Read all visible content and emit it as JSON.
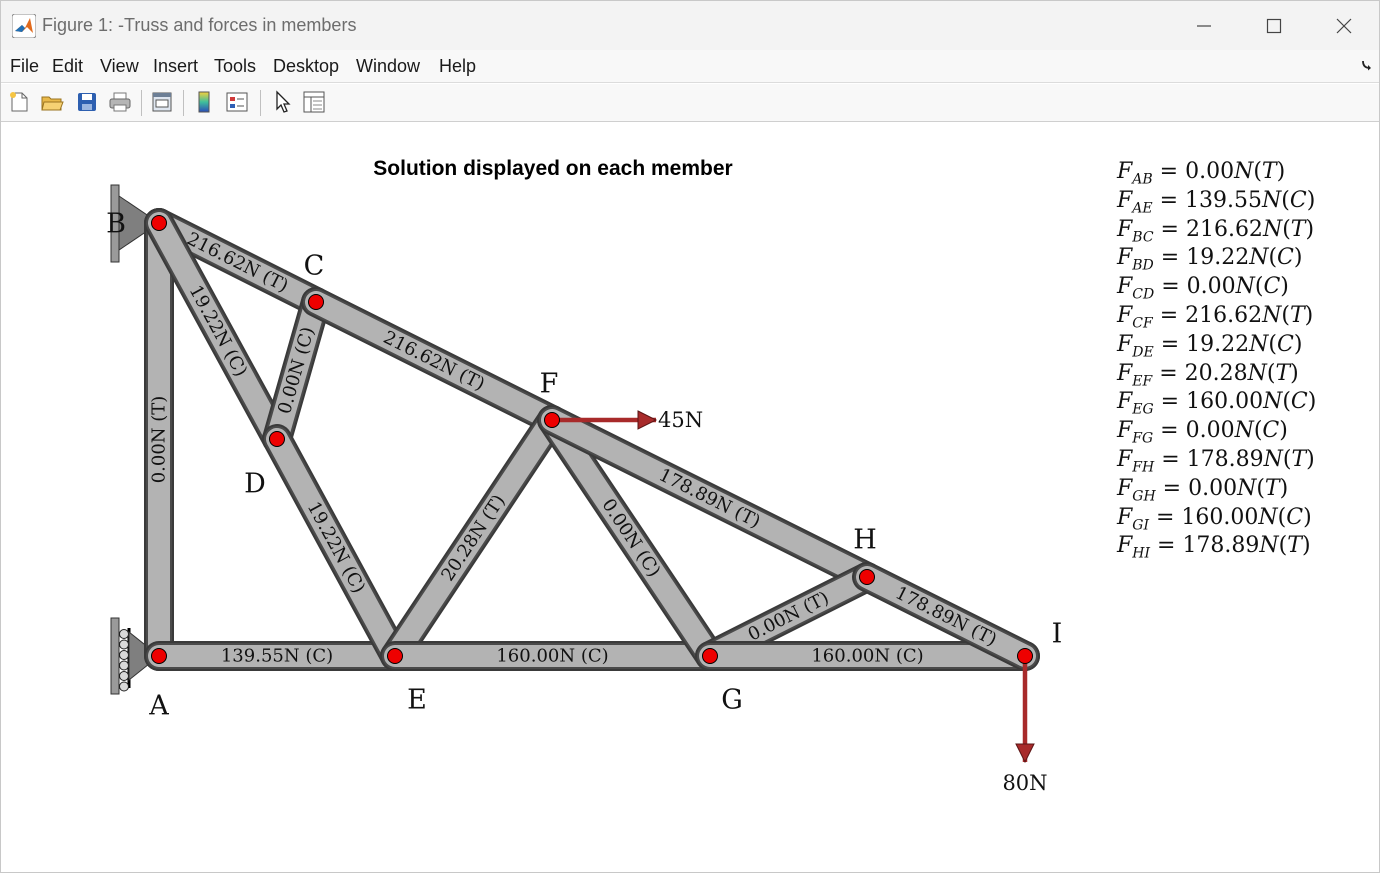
{
  "window": {
    "title": "Figure 1: -Truss and forces in members",
    "controls": [
      "minimize",
      "maximize",
      "close"
    ]
  },
  "menu": [
    "File",
    "Edit",
    "View",
    "Insert",
    "Tools",
    "Desktop",
    "Window",
    "Help"
  ],
  "toolbar": {
    "icons": [
      "new-figure-icon",
      "open-file-icon",
      "save-icon",
      "print-icon",
      "link-plot-icon",
      "colorbar-icon",
      "legend-icon",
      "pointer-icon",
      "property-inspector-icon"
    ]
  },
  "figure": {
    "title": "Solution displayed on each member",
    "nodes": [
      "A",
      "B",
      "C",
      "D",
      "E",
      "F",
      "G",
      "H",
      "I"
    ],
    "members": [
      {
        "id": "AB",
        "label": "0.00N (T)"
      },
      {
        "id": "AE",
        "label": "139.55N (C)"
      },
      {
        "id": "BC",
        "label": "216.62N (T)"
      },
      {
        "id": "BD",
        "label": "19.22N (C)"
      },
      {
        "id": "CD",
        "label": "0.00N (C)"
      },
      {
        "id": "CF",
        "label": "216.62N (T)"
      },
      {
        "id": "DE",
        "label": "19.22N (C)"
      },
      {
        "id": "EF",
        "label": "20.28N (T)"
      },
      {
        "id": "EG",
        "label": "160.00N (C)"
      },
      {
        "id": "FG",
        "label": "0.00N (C)"
      },
      {
        "id": "FH",
        "label": "178.89N (T)"
      },
      {
        "id": "GH",
        "label": "0.00N (T)"
      },
      {
        "id": "GI",
        "label": "160.00N (C)"
      },
      {
        "id": "HI",
        "label": "178.89N (T)"
      }
    ],
    "loads": [
      {
        "node": "F",
        "label": "45N",
        "direction": "right"
      },
      {
        "node": "I",
        "label": "80N",
        "direction": "down"
      }
    ],
    "results": [
      {
        "sub": "AB",
        "value": "0.00",
        "unit": "N",
        "type": "T"
      },
      {
        "sub": "AE",
        "value": "139.55",
        "unit": "N",
        "type": "C"
      },
      {
        "sub": "BC",
        "value": "216.62",
        "unit": "N",
        "type": "T"
      },
      {
        "sub": "BD",
        "value": "19.22",
        "unit": "N",
        "type": "C"
      },
      {
        "sub": "CD",
        "value": "0.00",
        "unit": "N",
        "type": "C"
      },
      {
        "sub": "CF",
        "value": "216.62",
        "unit": "N",
        "type": "T"
      },
      {
        "sub": "DE",
        "value": "19.22",
        "unit": "N",
        "type": "C"
      },
      {
        "sub": "EF",
        "value": "20.28",
        "unit": "N",
        "type": "T"
      },
      {
        "sub": "EG",
        "value": "160.00",
        "unit": "N",
        "type": "C"
      },
      {
        "sub": "FG",
        "value": "0.00",
        "unit": "N",
        "type": "C"
      },
      {
        "sub": "FH",
        "value": "178.89",
        "unit": "N",
        "type": "T"
      },
      {
        "sub": "GH",
        "value": "0.00",
        "unit": "N",
        "type": "T"
      },
      {
        "sub": "GI",
        "value": "160.00",
        "unit": "N",
        "type": "C"
      },
      {
        "sub": "HI",
        "value": "178.89",
        "unit": "N",
        "type": "T"
      }
    ]
  },
  "colors": {
    "member_fill": "#b3b3b3",
    "member_edge": "#4a4a4a",
    "node_fill": "#ee0000",
    "load_arrow": "#a82a2a",
    "support_fill": "#8c8c8c"
  }
}
